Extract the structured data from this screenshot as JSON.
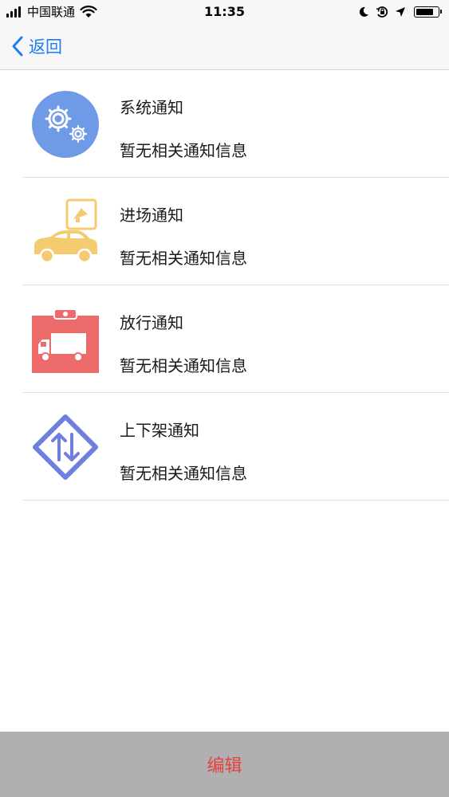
{
  "status_bar": {
    "carrier": "中国联通",
    "time": "11:35"
  },
  "nav": {
    "back_label": "返回"
  },
  "notifications": [
    {
      "title": "系统通知",
      "subtitle": "暂无相关通知信息",
      "icon": "gear-icon",
      "color": "#6f9ae6"
    },
    {
      "title": "进场通知",
      "subtitle": "暂无相关通知信息",
      "icon": "car-icon",
      "color": "#f5cb72"
    },
    {
      "title": "放行通知",
      "subtitle": "暂无相关通知信息",
      "icon": "truck-icon",
      "color": "#ee6b6b"
    },
    {
      "title": "上下架通知",
      "subtitle": "暂无相关通知信息",
      "icon": "shelf-arrows-icon",
      "color": "#6e7fe0"
    }
  ],
  "bottom": {
    "edit_label": "编辑"
  },
  "colors": {
    "accent": "#1b7cf6",
    "edit": "#e8413a",
    "bottom_bar": "#b0b0b2"
  }
}
